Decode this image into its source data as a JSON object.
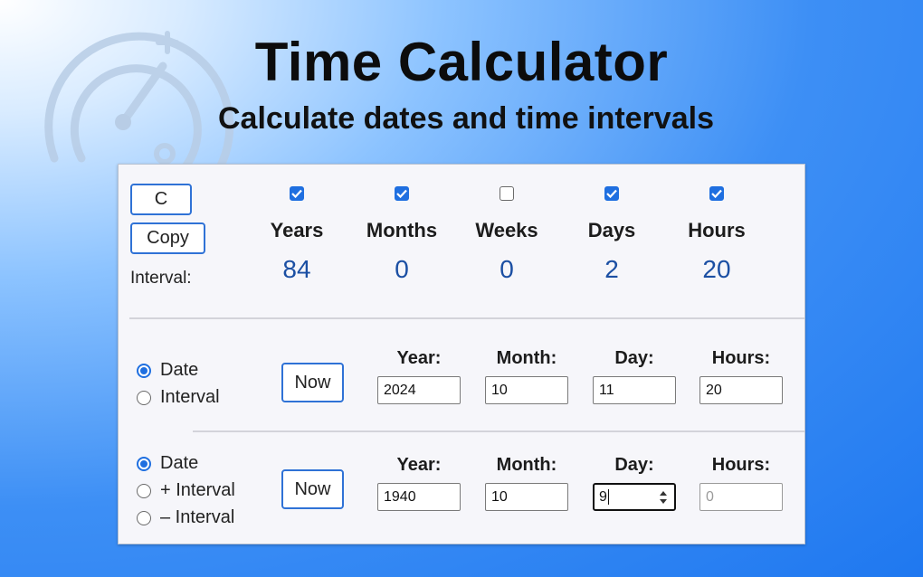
{
  "header": {
    "title": "Time Calculator",
    "subtitle": "Calculate dates and time intervals"
  },
  "top": {
    "clear_label": "C",
    "copy_label": "Copy",
    "interval_label": "Interval:",
    "units": [
      {
        "name": "Years",
        "checked": true,
        "value": "84"
      },
      {
        "name": "Months",
        "checked": true,
        "value": "0"
      },
      {
        "name": "Weeks",
        "checked": false,
        "value": "0"
      },
      {
        "name": "Days",
        "checked": true,
        "value": "2"
      },
      {
        "name": "Hours",
        "checked": true,
        "value": "20"
      }
    ]
  },
  "row1": {
    "radios": [
      {
        "label": "Date",
        "selected": true
      },
      {
        "label": "Interval",
        "selected": false
      }
    ],
    "now_label": "Now",
    "fields": [
      {
        "label": "Year:",
        "value": "2024"
      },
      {
        "label": "Month:",
        "value": "10"
      },
      {
        "label": "Day:",
        "value": "11"
      },
      {
        "label": "Hours:",
        "value": "20"
      }
    ]
  },
  "row2": {
    "radios": [
      {
        "label": "Date",
        "selected": true
      },
      {
        "label": "+ Interval",
        "selected": false
      },
      {
        "label": "– Interval",
        "selected": false
      }
    ],
    "now_label": "Now",
    "fields": [
      {
        "label": "Year:",
        "value": "1940"
      },
      {
        "label": "Month:",
        "value": "10"
      },
      {
        "label": "Day:",
        "value": "9"
      },
      {
        "label": "Hours:",
        "value": "",
        "placeholder": "0"
      }
    ]
  },
  "colors": {
    "accent": "#1f6fe0",
    "value_text": "#1b4fa3",
    "panel_bg": "#f6f6fa"
  },
  "icons": [
    "stopwatch-logo-icon",
    "checkbox-checked-icon",
    "spinner-arrows-icon"
  ]
}
